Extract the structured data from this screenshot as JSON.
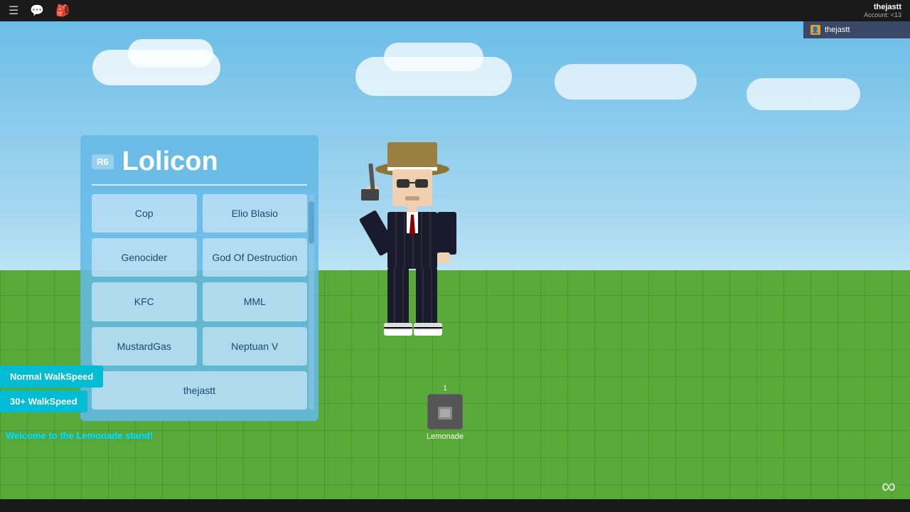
{
  "topbar": {
    "username": "thejastt",
    "account_label": "Account: <13",
    "user_badge": "thejastt"
  },
  "panel": {
    "badge": "R6",
    "title": "Lolicon",
    "buttons": [
      {
        "label": "Cop",
        "id": "cop",
        "full": false
      },
      {
        "label": "Elio Blasio",
        "id": "elio-blasio",
        "full": false
      },
      {
        "label": "Genocider",
        "id": "genocider",
        "full": false
      },
      {
        "label": "God Of Destruction",
        "id": "god-of-destruction",
        "full": false
      },
      {
        "label": "KFC",
        "id": "kfc",
        "full": false
      },
      {
        "label": "MML",
        "id": "mml",
        "full": false
      },
      {
        "label": "MustardGas",
        "id": "mustardgas",
        "full": false
      },
      {
        "label": "Neptuan V",
        "id": "neptuan-v",
        "full": false
      },
      {
        "label": "thejastt",
        "id": "thejastt",
        "full": true
      }
    ]
  },
  "walkspeed": {
    "normal_label": "Normal WalkSpeed",
    "boost_label": "30+ WalkSpeed"
  },
  "welcome": {
    "text": "Welcome to the Lemonade stand!"
  },
  "lemonade": {
    "count": "1",
    "label": "Lemonade"
  },
  "icons": {
    "menu": "☰",
    "chat": "💬",
    "bag": "🎒",
    "infinity": "∞"
  }
}
